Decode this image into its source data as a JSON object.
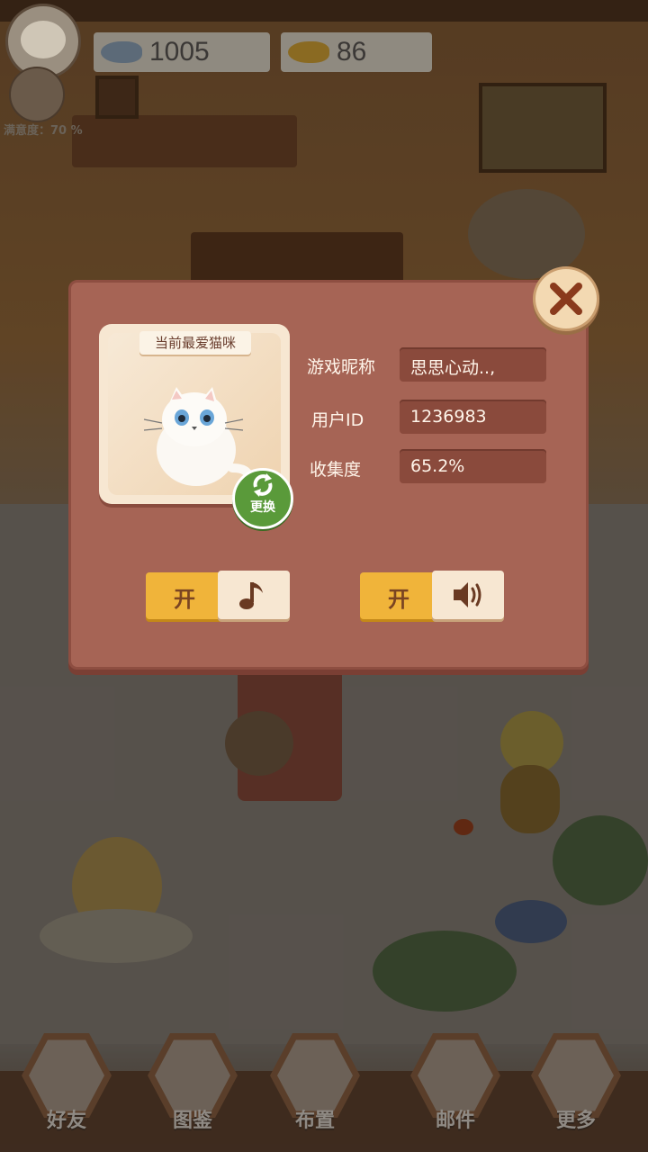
{
  "hud": {
    "satisfaction": "满意度：70 %",
    "fish_silver": "1005",
    "fish_gold": "86",
    "fish_silver_icon": "silver-fish-icon",
    "fish_gold_icon": "gold-fish-icon"
  },
  "dialog": {
    "card_tag": "当前最爱猫咪",
    "swap_label": "更换",
    "rows": [
      {
        "label": "游戏昵称",
        "value": "思思心动..,"
      },
      {
        "label": "用户ID",
        "value": "1236983"
      },
      {
        "label": "收集度",
        "value": "65.2%"
      }
    ],
    "music_toggle": "开",
    "sound_toggle": "开",
    "music_icon": "music-note-icon",
    "sound_icon": "speaker-icon",
    "close_icon": "close-icon"
  },
  "nav": {
    "items": [
      {
        "label": "好友"
      },
      {
        "label": "图鉴"
      },
      {
        "label": "布置"
      },
      {
        "label": "邮件"
      },
      {
        "label": "更多"
      }
    ]
  },
  "colors": {
    "dialog_bg": "#a66455",
    "toggle_on": "#f0b43a",
    "card_bg": "#f7e7d2",
    "swap_green": "#5a9a3a"
  }
}
